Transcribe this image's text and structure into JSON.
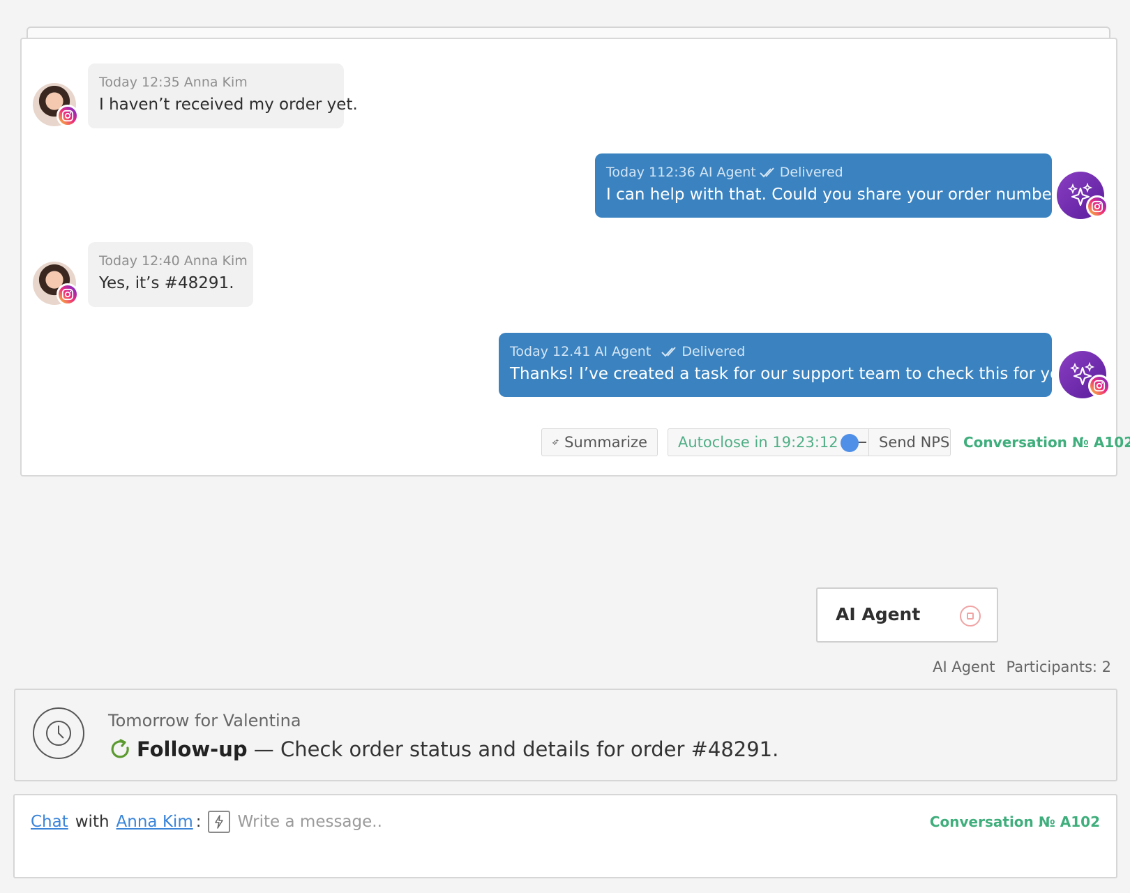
{
  "messages": [
    {
      "direction": "in",
      "meta": "Today 12:35 Anna Kim",
      "text": "I haven’t received my order yet.",
      "avatar": "user-avatar",
      "channel": "instagram-icon"
    },
    {
      "direction": "out",
      "meta_time": "Today 112:36 AI Agent",
      "status": "Delivered",
      "text": "I can help with that. Could you share your order number?",
      "avatar": "ai-agent-avatar",
      "channel": "instagram-icon"
    },
    {
      "direction": "in",
      "meta": "Today 12:40 Anna Kim",
      "text": "Yes, it’s #48291.",
      "avatar": "user-avatar",
      "channel": "instagram-icon"
    },
    {
      "direction": "out",
      "meta_time": "Today 12.41 AI Agent",
      "status": "Delivered",
      "text": "Thanks! I’ve created a task for our support team to check this for you.",
      "avatar": "ai-agent-avatar",
      "channel": "instagram-icon"
    }
  ],
  "toolbar": {
    "summarize_label": "Summarize",
    "autoclose_label": "Autoclose in 19:23:12",
    "autoclose_enabled": true,
    "send_nps_label": "Send NPS",
    "conversation_number": "Conversation № A102"
  },
  "agent_box": {
    "label": "AI Agent",
    "stop_icon": "stop-icon"
  },
  "participants": {
    "agent": "AI Agent",
    "count_label": "Participants: 2"
  },
  "task": {
    "when": "Tomorrow for Valentina",
    "type": "Follow-up",
    "description": " — Check order status and details for order #48291."
  },
  "compose": {
    "chat_link": "Chat",
    "with": "with",
    "contact_link": "Anna Kim",
    "colon": ":",
    "placeholder": "Write a message..",
    "conversation_number": "Conversation № A102"
  },
  "colors": {
    "outgoing_bubble": "#3a83c0",
    "accent_green": "#3fae7c",
    "link_blue": "#3a84d9",
    "toggle_blue": "#4f8fe8"
  }
}
